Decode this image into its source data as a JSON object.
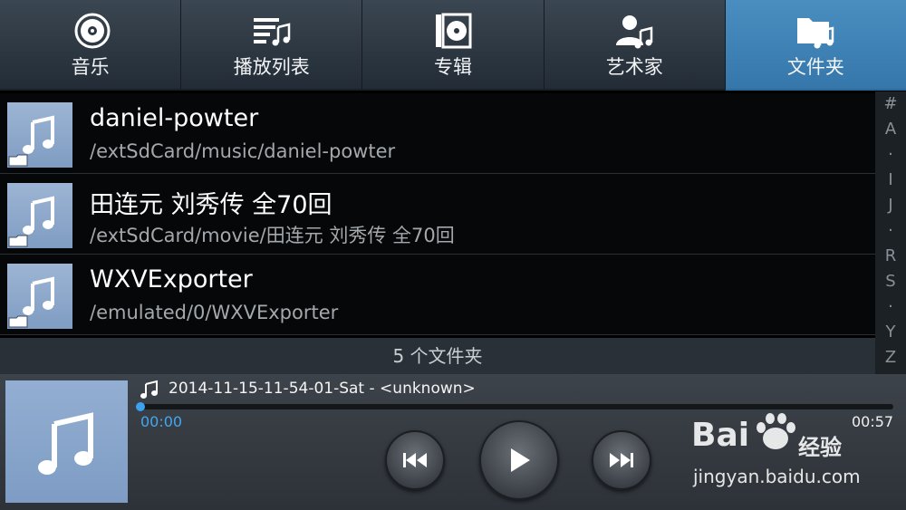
{
  "tabs": [
    {
      "label": "音乐",
      "icon": "disc-icon",
      "active": false
    },
    {
      "label": "播放列表",
      "icon": "playlist-icon",
      "active": false
    },
    {
      "label": "专辑",
      "icon": "album-icon",
      "active": false
    },
    {
      "label": "艺术家",
      "icon": "artist-icon",
      "active": false
    },
    {
      "label": "文件夹",
      "icon": "folder-music-icon",
      "active": true
    }
  ],
  "folders": [
    {
      "title": "daniel-powter",
      "path": "/extSdCard/music/daniel-powter"
    },
    {
      "title": "田连元 刘秀传 全70回",
      "path": "/extSdCard/movie/田连元 刘秀传 全70回"
    },
    {
      "title": "WXVExporter",
      "path": "/emulated/0/WXVExporter"
    }
  ],
  "folder_count": "5 个文件夹",
  "index_bar": [
    "#",
    "A",
    "·",
    "I",
    "J",
    "·",
    "R",
    "S",
    "·",
    "Y",
    "Z"
  ],
  "player": {
    "track_title": "2014-11-15-11-54-01-Sat - <unknown>",
    "elapsed": "00:00",
    "total": "00:57",
    "progress": 0.0
  },
  "watermark": {
    "brand": "Bai",
    "brand2": "经验",
    "url": "jingyan.baidu.com"
  },
  "colors": {
    "accent": "#3a92db",
    "active_tab": "#3f84b8",
    "thumb": "#8ea8cc"
  }
}
